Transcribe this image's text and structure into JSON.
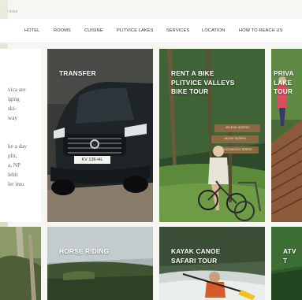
{
  "breadcrumb": "rices",
  "nav": {
    "items": [
      "HOTEL",
      "ROOMS",
      "CUISINE",
      "PLITVICE LAKES",
      "SERVICES",
      "LOCATION",
      "HOW TO REACH US"
    ]
  },
  "intro": {
    "lines": [
      "vica are",
      "lging",
      "ski-",
      "way",
      "ke a day",
      "plit,",
      "a, NP",
      "lebit",
      "ler into"
    ]
  },
  "tiles": [
    {
      "title": "TRANSFER",
      "lines": [
        "TRANSFER"
      ],
      "plate": "KV 136-HL"
    },
    {
      "title": "RENT A BIKE PLITVICE VALLEYS BIKE TOUR",
      "lines": [
        "RENT A BIKE",
        "PLITVICE VALLEYS",
        "BIKE TOUR"
      ],
      "signs": [
        "ZELENO JEZERO",
        "SKOVE JEZERO",
        "KOZJAKOVO JEZERO"
      ]
    },
    {
      "title": "PRIVATE LAKES TOUR",
      "lines": [
        "PRIVA",
        "LAKE",
        "TOUR"
      ]
    },
    {
      "title": "HORSE RIDING",
      "lines": [
        "HORSE RIDING"
      ]
    },
    {
      "title": "KAYAK CANOE SAFARI TOUR",
      "lines": [
        "KAYAK CANOE",
        "SAFARI TOUR"
      ]
    },
    {
      "title": "ATV TOUR",
      "lines": [
        "ATV T"
      ]
    }
  ]
}
